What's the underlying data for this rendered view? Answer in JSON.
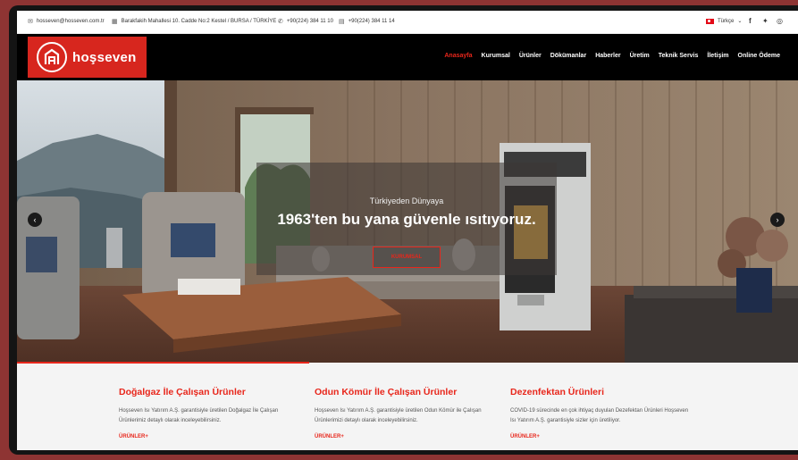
{
  "topbar": {
    "email": "hosseven@hosseven.com.tr",
    "address": "Barakfakih Mahallesi 10. Cadde No:2 Kestel / BURSA / TÜRKİYE",
    "phone": "+90(224) 384 11 10",
    "fax": "+90(224) 384 11 14",
    "language": "Türkçe",
    "social": [
      "facebook-icon",
      "twitter-icon",
      "instagram-icon"
    ]
  },
  "brand": {
    "name": "hoşseven",
    "color": "#d7261e"
  },
  "nav": {
    "items": [
      "Anasayfa",
      "Kurumsal",
      "Ürünler",
      "Dökümanlar",
      "Haberler",
      "Üretim",
      "Teknik Servis",
      "İletişim",
      "Online Ödeme"
    ],
    "active_index": 0
  },
  "hero": {
    "subtitle": "Türkiyeden Dünyaya",
    "title": "1963'ten bu yana güvenle ısıtıyoruz.",
    "button": "KURUMSAL"
  },
  "cards": [
    {
      "title": "Doğalgaz İle Çalışan Ürünler",
      "text": "Hoşseven Isı Yatırım A.Ş. garantisiyle üretilen Doğalgaz İle Çalışan Ürünlerimiz detaylı olarak inceleyebilirsiniz.",
      "link": "ÜRÜNLER+"
    },
    {
      "title": "Odun Kömür İle Çalışan Ürünler",
      "text": "Hoşseven Isı Yatırım A.Ş. garantisiyle üretilen Odun Kömür ile Çalışan Ürünlerimizi detaylı olarak inceleyebilirsiniz.",
      "link": "ÜRÜNLER+"
    },
    {
      "title": "Dezenfektan Ürünleri",
      "text": "COVID-19 sürecinde en çok ihtiyaç duyulan Dezefektan Ürünleri Hoşseven Isı Yatırım A.Ş. garantisiyle sizler için üretiliyor.",
      "link": "ÜRÜNLER+"
    }
  ],
  "accent_color": "#e8261b"
}
